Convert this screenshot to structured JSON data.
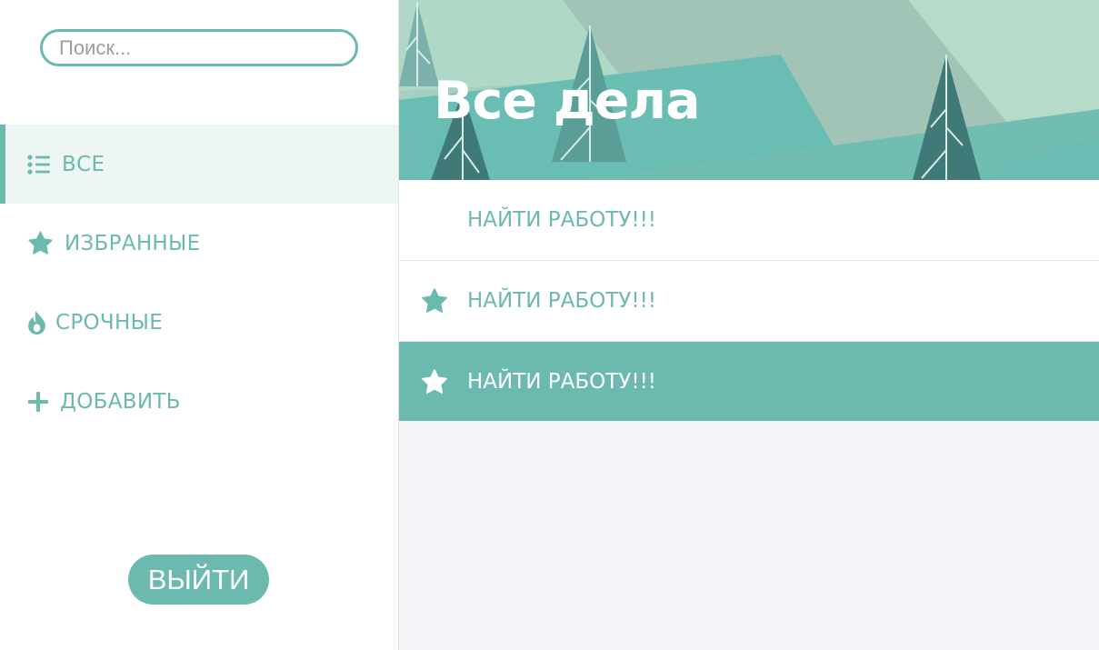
{
  "search": {
    "placeholder": "Поиск..."
  },
  "sidebar": {
    "items": [
      {
        "label": "ВСЕ",
        "icon": "list-icon",
        "active": true
      },
      {
        "label": "ИЗБРАННЫЕ",
        "icon": "star-icon",
        "active": false
      },
      {
        "label": "СРОЧНЫЕ",
        "icon": "fire-icon",
        "active": false
      },
      {
        "label": "ДОБАВИТЬ",
        "icon": "plus-icon",
        "active": false
      }
    ],
    "logout_label": "ВЫЙТИ"
  },
  "main": {
    "title": "Все дела",
    "tasks": [
      {
        "label": "НАЙТИ РАБОТУ!!!",
        "starred": false,
        "selected": false
      },
      {
        "label": "НАЙТИ РАБОТУ!!!",
        "starred": true,
        "selected": false
      },
      {
        "label": "НАЙТИ РАБОТУ!!!",
        "starred": true,
        "selected": true
      }
    ]
  },
  "colors": {
    "accent": "#6cb9b0",
    "active_bg": "#eef6f4",
    "main_bg": "#f5f4f9",
    "text_on_accent": "#ffffff"
  }
}
